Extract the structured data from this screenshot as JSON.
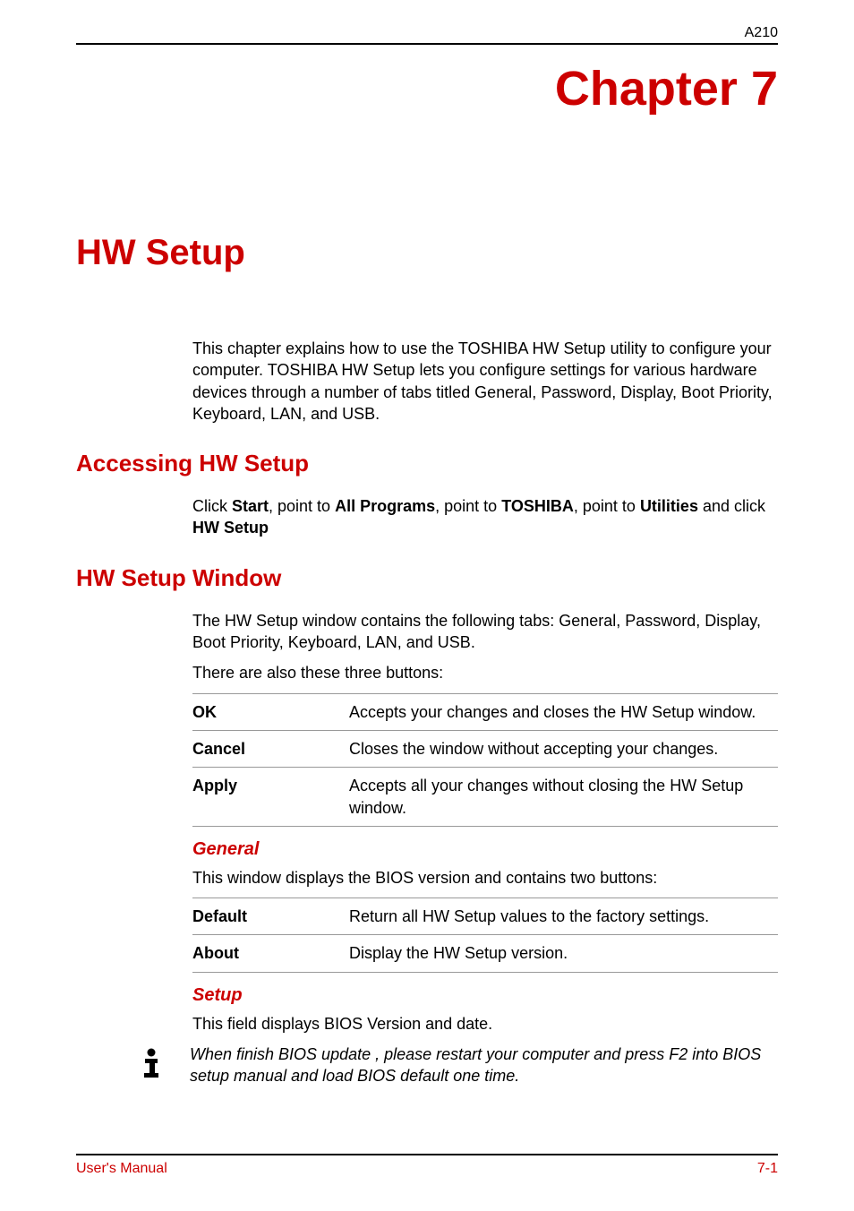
{
  "header": {
    "label": "A210"
  },
  "chapter": {
    "title": "Chapter 7"
  },
  "page": {
    "title": "HW Setup"
  },
  "intro": {
    "text": "This chapter explains how to use the TOSHIBA HW Setup utility to configure your computer. TOSHIBA HW Setup lets you configure settings for various hardware devices through a number of tabs titled General, Password, Display, Boot Priority, Keyboard, LAN, and USB."
  },
  "accessing": {
    "heading": "Accessing HW Setup",
    "segments": {
      "click": "Click ",
      "start": "Start",
      "point1": ", point to ",
      "allPrograms": "All Programs",
      "point2": ", point to ",
      "toshiba": "TOSHIBA",
      "point3": ", point to ",
      "utilities": "Utilities",
      "andClick": " and click ",
      "hwSetup": "HW Setup"
    }
  },
  "window": {
    "heading": "HW Setup Window",
    "para1": "The HW Setup window contains the following tabs: General, Password, Display, Boot Priority, Keyboard, LAN, and USB.",
    "para2": "There are also these three buttons:",
    "buttons": [
      {
        "label": "OK",
        "desc": "Accepts your changes and closes the HW Setup window."
      },
      {
        "label": "Cancel",
        "desc": "Closes the window without accepting your changes."
      },
      {
        "label": "Apply",
        "desc": "Accepts all your changes without closing the HW Setup window."
      }
    ]
  },
  "general": {
    "heading": "General",
    "intro": "This window displays the BIOS version and contains two buttons:",
    "buttons": [
      {
        "label": "Default",
        "desc": "Return all HW Setup values to the factory settings."
      },
      {
        "label": "About",
        "desc": "Display the HW Setup version."
      }
    ]
  },
  "setup": {
    "heading": "Setup",
    "text": "This field displays BIOS Version and date."
  },
  "note": {
    "text": "When finish BIOS update , please restart your computer and press F2 into BIOS setup manual and load BIOS default one time."
  },
  "footer": {
    "left": "User's Manual",
    "right": "7-1"
  }
}
